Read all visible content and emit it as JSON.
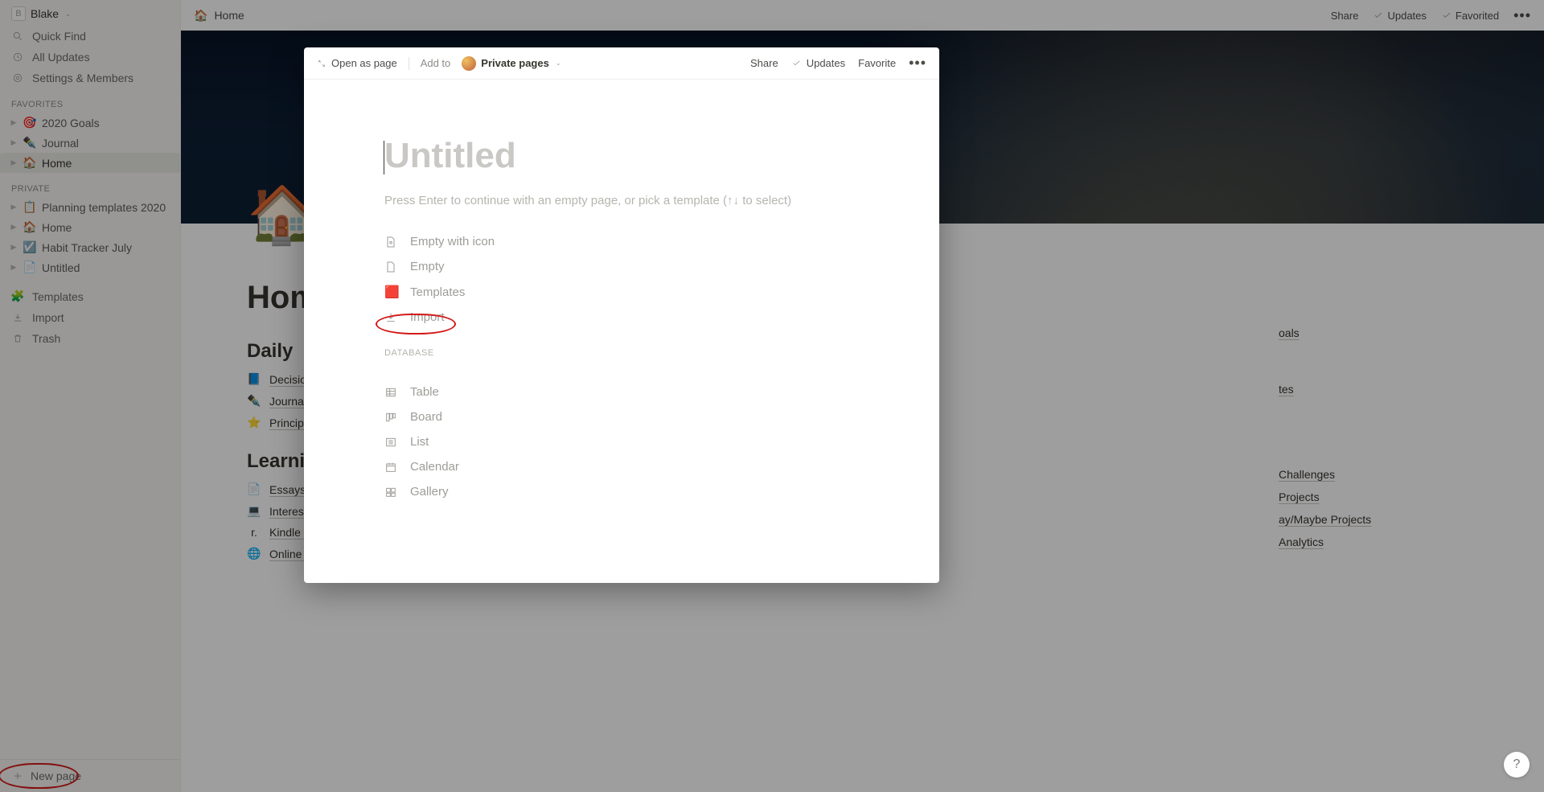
{
  "workspace": {
    "name": "Blake",
    "expand_glyph": "⌄"
  },
  "sidebar": {
    "quick_find": "Quick Find",
    "all_updates": "All Updates",
    "settings": "Settings & Members",
    "favorites_label": "FAVORITES",
    "favorites": [
      {
        "emoji": "🎯",
        "label": "2020 Goals"
      },
      {
        "emoji": "✒️",
        "label": "Journal"
      },
      {
        "emoji": "🏠",
        "label": "Home",
        "selected": true
      }
    ],
    "private_label": "PRIVATE",
    "private": [
      {
        "emoji": "📋",
        "label": "Planning templates 2020"
      },
      {
        "emoji": "🏠",
        "label": "Home"
      },
      {
        "emoji": "☑️",
        "label": "Habit Tracker July"
      },
      {
        "emoji": "📄",
        "label": "Untitled"
      }
    ],
    "templates": "Templates",
    "import": "Import",
    "trash": "Trash",
    "new_page": "New page"
  },
  "topbar": {
    "breadcrumb_icon": "🏠",
    "breadcrumb": "Home",
    "share": "Share",
    "updates": "Updates",
    "favorited": "Favorited",
    "more": "•••"
  },
  "page": {
    "icon": "🏠",
    "title": "Home",
    "sections": {
      "daily_h": "Daily",
      "daily": [
        {
          "emoji": "📘",
          "label": "Decision"
        },
        {
          "emoji": "✒️",
          "label": "Journal"
        },
        {
          "emoji": "⭐",
          "label": "Principle"
        }
      ],
      "learning_h": "Learning",
      "learning": [
        {
          "emoji": "📄",
          "label": "Essays t"
        },
        {
          "emoji": "💻",
          "label": "Interest"
        },
        {
          "emoji": "r.",
          "label": "Kindle H"
        },
        {
          "emoji": "🌐",
          "label": "Online C"
        }
      ]
    }
  },
  "right_col": [
    {
      "label": "oals"
    },
    {
      "label": "tes"
    },
    {
      "label": "Challenges"
    },
    {
      "label": "Projects"
    },
    {
      "label": "ay/Maybe Projects"
    },
    {
      "label": "Analytics"
    }
  ],
  "modal": {
    "open_as_page": "Open as page",
    "add_to": "Add to",
    "add_to_dest": "Private pages",
    "share": "Share",
    "updates": "Updates",
    "favorite": "Favorite",
    "more": "•••",
    "title_placeholder": "Untitled",
    "hint": "Press Enter to continue with an empty page, or pick a template (↑↓ to select)",
    "options": [
      {
        "icon": "page-icon",
        "label": "Empty with icon"
      },
      {
        "icon": "page",
        "label": "Empty"
      },
      {
        "icon": "templates",
        "label": "Templates"
      },
      {
        "icon": "import",
        "label": "Import"
      }
    ],
    "db_label": "DATABASE",
    "db_options": [
      {
        "icon": "table",
        "label": "Table"
      },
      {
        "icon": "board",
        "label": "Board"
      },
      {
        "icon": "list",
        "label": "List"
      },
      {
        "icon": "calendar",
        "label": "Calendar"
      },
      {
        "icon": "gallery",
        "label": "Gallery"
      }
    ]
  },
  "help": "?"
}
